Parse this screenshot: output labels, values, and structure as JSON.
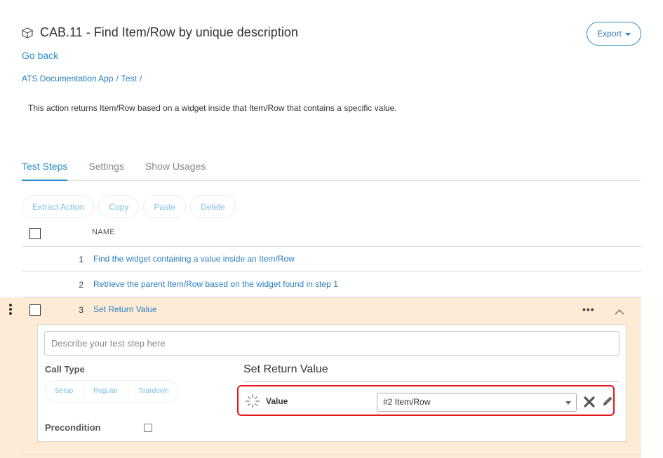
{
  "header": {
    "icon": "cube-icon",
    "title": "CAB.11 - Find Item/Row by unique description",
    "export_label": "Export",
    "go_back": "Go back"
  },
  "breadcrumb": {
    "items": [
      "ATS Documentation App",
      "Test"
    ],
    "separator": "/"
  },
  "description": "This action returns Item/Row based on a widget inside that Item/Row that contains a specific value.",
  "tabs": [
    {
      "label": "Test Steps",
      "active": true
    },
    {
      "label": "Settings",
      "active": false
    },
    {
      "label": "Show Usages",
      "active": false
    }
  ],
  "toolbar": {
    "extract_action": "Extract Action",
    "copy": "Copy",
    "paste": "Paste",
    "delete": "Delete"
  },
  "table": {
    "header_name": "NAME",
    "rows": [
      {
        "num": "1",
        "name": "Find the widget containing a value inside an Item/Row"
      },
      {
        "num": "2",
        "name": "Retrieve the parent Item/Row based on the widget found in step 1"
      },
      {
        "num": "3",
        "name": "Set Return Value"
      }
    ]
  },
  "step_editor": {
    "description_placeholder": "Describe your test step here",
    "call_type_label": "Call Type",
    "call_types": [
      "Setup",
      "Regular",
      "Teardown"
    ],
    "precondition_label": "Precondition",
    "action_title": "Set Return Value",
    "value_label": "Value",
    "value_selected": "#2 Item/Row"
  },
  "colors": {
    "accent": "#2a8fc6",
    "highlight_row": "#fdebd6",
    "highlight_border": "#e5161e"
  }
}
